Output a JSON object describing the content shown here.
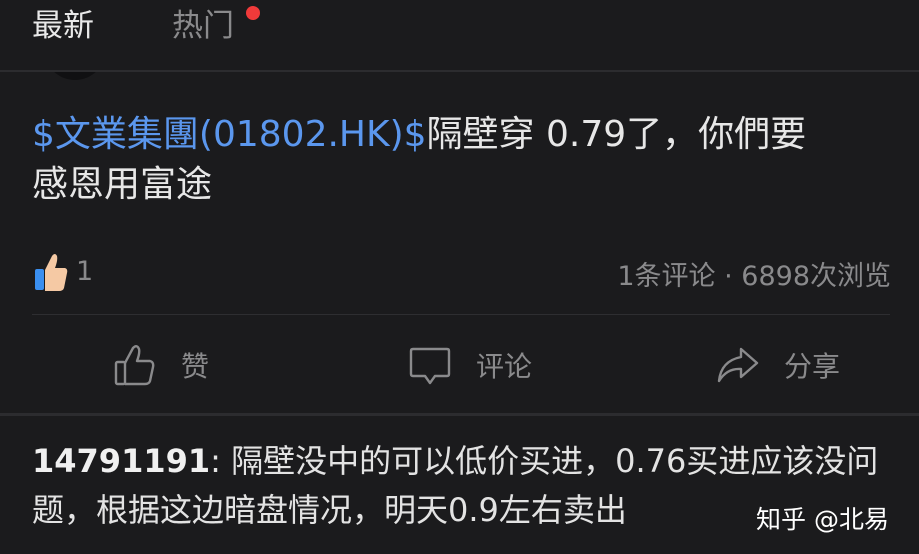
{
  "tabs": {
    "latest": "最新",
    "hot": "热门"
  },
  "post": {
    "stock_link": "$文業集團(01802.HK)$",
    "text_line1": "隔壁穿 0.79了，你們要",
    "text_line2": "感恩用富途",
    "like_count": "1",
    "stats": "1条评论 · 6898次浏览"
  },
  "actions": {
    "like_label": "赞",
    "comment_label": "评论",
    "share_label": "分享"
  },
  "comment": {
    "user": "14791191",
    "separator": ": ",
    "text": "隔壁没中的可以低价买进，0.76买进应该没问题，根据这边暗盘情况，明天0.9左右卖出"
  },
  "watermark": "知乎 @北易",
  "colors": {
    "background": "#1b1b1d",
    "link": "#5b97ee",
    "notification_dot": "#f03a3a",
    "muted_text": "#8a8a8c"
  },
  "icons": {
    "like": "thumbs-up-icon",
    "comment": "speech-bubble-icon",
    "share": "share-arrow-icon"
  }
}
